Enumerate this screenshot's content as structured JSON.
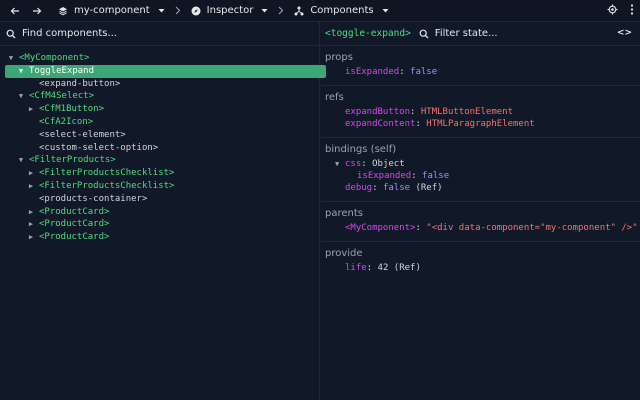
{
  "topbar": {
    "back_icon": "arrow-left-icon",
    "forward_icon": "arrow-right-icon",
    "crumbs": [
      {
        "label": "my-component",
        "icon": "layers-icon"
      },
      {
        "label": "Inspector",
        "icon": "compass-icon"
      },
      {
        "label": "Components",
        "icon": "components-icon"
      }
    ]
  },
  "left": {
    "search_placeholder": "Find components...",
    "tree": [
      {
        "label": "<MyComponent>",
        "depth": 0,
        "expander": "open",
        "kind": "tag",
        "selected": false
      },
      {
        "label": "ToggleExpand",
        "depth": 1,
        "expander": "open",
        "kind": "tag",
        "selected": true
      },
      {
        "label": "<expand-button>",
        "depth": 2,
        "expander": "none",
        "kind": "plain",
        "selected": false
      },
      {
        "label": "<CfM4Select>",
        "depth": 1,
        "expander": "open",
        "kind": "tag",
        "selected": false
      },
      {
        "label": "<CfM1Button>",
        "depth": 2,
        "expander": "closed",
        "kind": "tag",
        "selected": false
      },
      {
        "label": "<CfA2Icon>",
        "depth": 2,
        "expander": "none",
        "kind": "tag",
        "selected": false
      },
      {
        "label": "<select-element>",
        "depth": 2,
        "expander": "none",
        "kind": "plain",
        "selected": false
      },
      {
        "label": "<custom-select-option>",
        "depth": 2,
        "expander": "none",
        "kind": "plain",
        "selected": false
      },
      {
        "label": "<FilterProducts>",
        "depth": 1,
        "expander": "open",
        "kind": "tag",
        "selected": false
      },
      {
        "label": "<FilterProductsChecklist>",
        "depth": 2,
        "expander": "closed",
        "kind": "tag",
        "selected": false
      },
      {
        "label": "<FilterProductsChecklist>",
        "depth": 2,
        "expander": "closed",
        "kind": "tag",
        "selected": false
      },
      {
        "label": "<products-container>",
        "depth": 2,
        "expander": "none",
        "kind": "plain",
        "selected": false
      },
      {
        "label": "<ProductCard>",
        "depth": 2,
        "expander": "closed",
        "kind": "tag",
        "selected": false
      },
      {
        "label": "<ProductCard>",
        "depth": 2,
        "expander": "closed",
        "kind": "tag",
        "selected": false
      },
      {
        "label": "<ProductCard>",
        "depth": 2,
        "expander": "closed",
        "kind": "tag",
        "selected": false
      }
    ]
  },
  "right": {
    "component_name": "<toggle-expand>",
    "filter_placeholder": "Filter state...",
    "code_label": "<>",
    "props": {
      "title": "props",
      "isExpanded_key": "isExpanded",
      "isExpanded_val": "false"
    },
    "refs": {
      "title": "refs",
      "expandButton_key": "expandButton",
      "expandButton_val": "HTMLButtonElement",
      "expandContent_key": "expandContent",
      "expandContent_val": "HTMLParagraphElement"
    },
    "bindings": {
      "title": "bindings (self)",
      "css_key": "css",
      "css_val": "Object",
      "css_isExpanded_key": "isExpanded",
      "css_isExpanded_val": "false",
      "debug_key": "debug",
      "debug_val": "false",
      "debug_suffix": "(Ref)"
    },
    "parents": {
      "title": "parents",
      "parent_key": "<MyComponent>",
      "parent_val": "\"<div data-component=\"my-component\" />\""
    },
    "provide": {
      "title": "provide",
      "life_key": "life",
      "life_val": "42",
      "life_suffix": "(Ref)"
    }
  },
  "colors": {
    "background": "#111827",
    "selection": "#3ba776",
    "tag_green": "#4ade80",
    "key_magenta": "#d946ef",
    "bool_purple": "#a78bfa",
    "string_red": "#f87171"
  }
}
